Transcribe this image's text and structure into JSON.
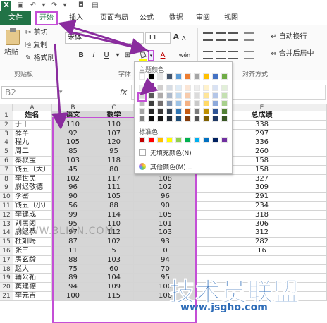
{
  "titlebar": {
    "logo": "X",
    "save_icon": "save-icon",
    "undo_icon": "undo-icon",
    "redo_icon": "redo-icon",
    "camera_icon": "camera-icon"
  },
  "tabs": [
    "文件",
    "开始",
    "插入",
    "页面布局",
    "公式",
    "数据",
    "审阅",
    "视图"
  ],
  "clipboard": {
    "paste": "粘贴",
    "cut": "剪切",
    "copy": "复制",
    "format_painter": "格式刷",
    "group_label": "剪贴板"
  },
  "font": {
    "name": "宋体",
    "size": "11",
    "bold": "B",
    "italic": "I",
    "underline": "U",
    "grow": "A",
    "shrink": "A",
    "font_color": "A",
    "phonetic": "wén",
    "group_label": "字体"
  },
  "alignment": {
    "wrap": "自动换行",
    "merge": "合并后居中",
    "group_label": "对齐方式"
  },
  "formula_bar": {
    "name_box": "B2",
    "fx": "fx"
  },
  "color_picker": {
    "theme_label": "主题颜色",
    "standard_label": "标准色",
    "no_fill": "无填充颜色(N)",
    "more": "其他颜色(M)...",
    "theme_top": [
      "#ffffff",
      "#000000",
      "#e7e6e6",
      "#44546a",
      "#5b9bd5",
      "#ed7d31",
      "#a5a5a5",
      "#ffc000",
      "#4472c4",
      "#70ad47"
    ],
    "theme_shades": [
      [
        "#f2f2f2",
        "#7f7f7f",
        "#d0cece",
        "#d6dce4",
        "#deebf6",
        "#fbe5d5",
        "#ededed",
        "#fff2cc",
        "#d9e2f3",
        "#e2efd9"
      ],
      [
        "#d8d8d8",
        "#595959",
        "#aeabab",
        "#adb9ca",
        "#bdd7ee",
        "#f7cbac",
        "#dbdbdb",
        "#fee599",
        "#b4c6e7",
        "#c5e0b3"
      ],
      [
        "#bfbfbf",
        "#3f3f3f",
        "#757070",
        "#8496b0",
        "#9dc3e6",
        "#f4b183",
        "#c9c9c9",
        "#ffd966",
        "#8eaadb",
        "#a8d08d"
      ],
      [
        "#a5a5a5",
        "#262626",
        "#3a3838",
        "#323f4f",
        "#2e75b5",
        "#c55a11",
        "#7b7b7b",
        "#bf9000",
        "#2f5496",
        "#538135"
      ],
      [
        "#7f7f7f",
        "#0c0c0c",
        "#171616",
        "#222a35",
        "#1e4d78",
        "#843c0b",
        "#525252",
        "#7f6000",
        "#1f3864",
        "#375623"
      ]
    ],
    "standard": [
      "#c00000",
      "#ff0000",
      "#ffc000",
      "#ffff00",
      "#92d050",
      "#00b050",
      "#00b0f0",
      "#0070c0",
      "#002060",
      "#7030a0"
    ]
  },
  "sheet": {
    "columns": [
      "A",
      "B",
      "C",
      "D",
      "E"
    ],
    "header": [
      "姓名",
      "语文",
      "数学",
      "",
      "总成绩"
    ],
    "rows": [
      [
        "于十",
        "110",
        "110",
        "",
        "338"
      ],
      [
        "薛芊",
        "92",
        "107",
        "",
        "297"
      ],
      [
        "程九",
        "105",
        "120",
        "",
        "336"
      ],
      [
        "周二",
        "85",
        "95",
        "",
        "260"
      ],
      [
        "秦叔宝",
        "103",
        "118",
        "",
        "158"
      ],
      [
        "钱五（大）",
        "45",
        "80",
        "33",
        "158"
      ],
      [
        "李世民",
        "102",
        "117",
        "108",
        "327"
      ],
      [
        "尉迟敬德",
        "96",
        "111",
        "102",
        "309"
      ],
      [
        "李密",
        "90",
        "105",
        "96",
        "291"
      ],
      [
        "钱五（小）",
        "56",
        "88",
        "90",
        "234"
      ],
      [
        "李建成",
        "99",
        "114",
        "105",
        "318"
      ],
      [
        "刘黑闼",
        "95",
        "110",
        "101",
        "306"
      ],
      [
        "尉迟恭",
        "97",
        "112",
        "103",
        "312"
      ],
      [
        "杜如晦",
        "87",
        "102",
        "93",
        "282"
      ],
      [
        "张三",
        "11",
        "5",
        "0",
        "16"
      ],
      [
        "房玄龄",
        "88",
        "103",
        "94",
        ""
      ],
      [
        "赵大",
        "75",
        "60",
        "70",
        ""
      ],
      [
        "辅公祏",
        "89",
        "104",
        "95",
        ""
      ],
      [
        "窦建德",
        "94",
        "109",
        "100",
        ""
      ],
      [
        "李元吉",
        "100",
        "115",
        "106",
        ""
      ]
    ]
  },
  "watermarks": {
    "site_faint": "WWW.3LIAN.COM",
    "brand": "技术员联盟",
    "url": "www.jsgho.com"
  },
  "colors": {
    "excel_green": "#217346",
    "highlight": "#c44fd6",
    "gray_fill": "#d6d6d6"
  }
}
